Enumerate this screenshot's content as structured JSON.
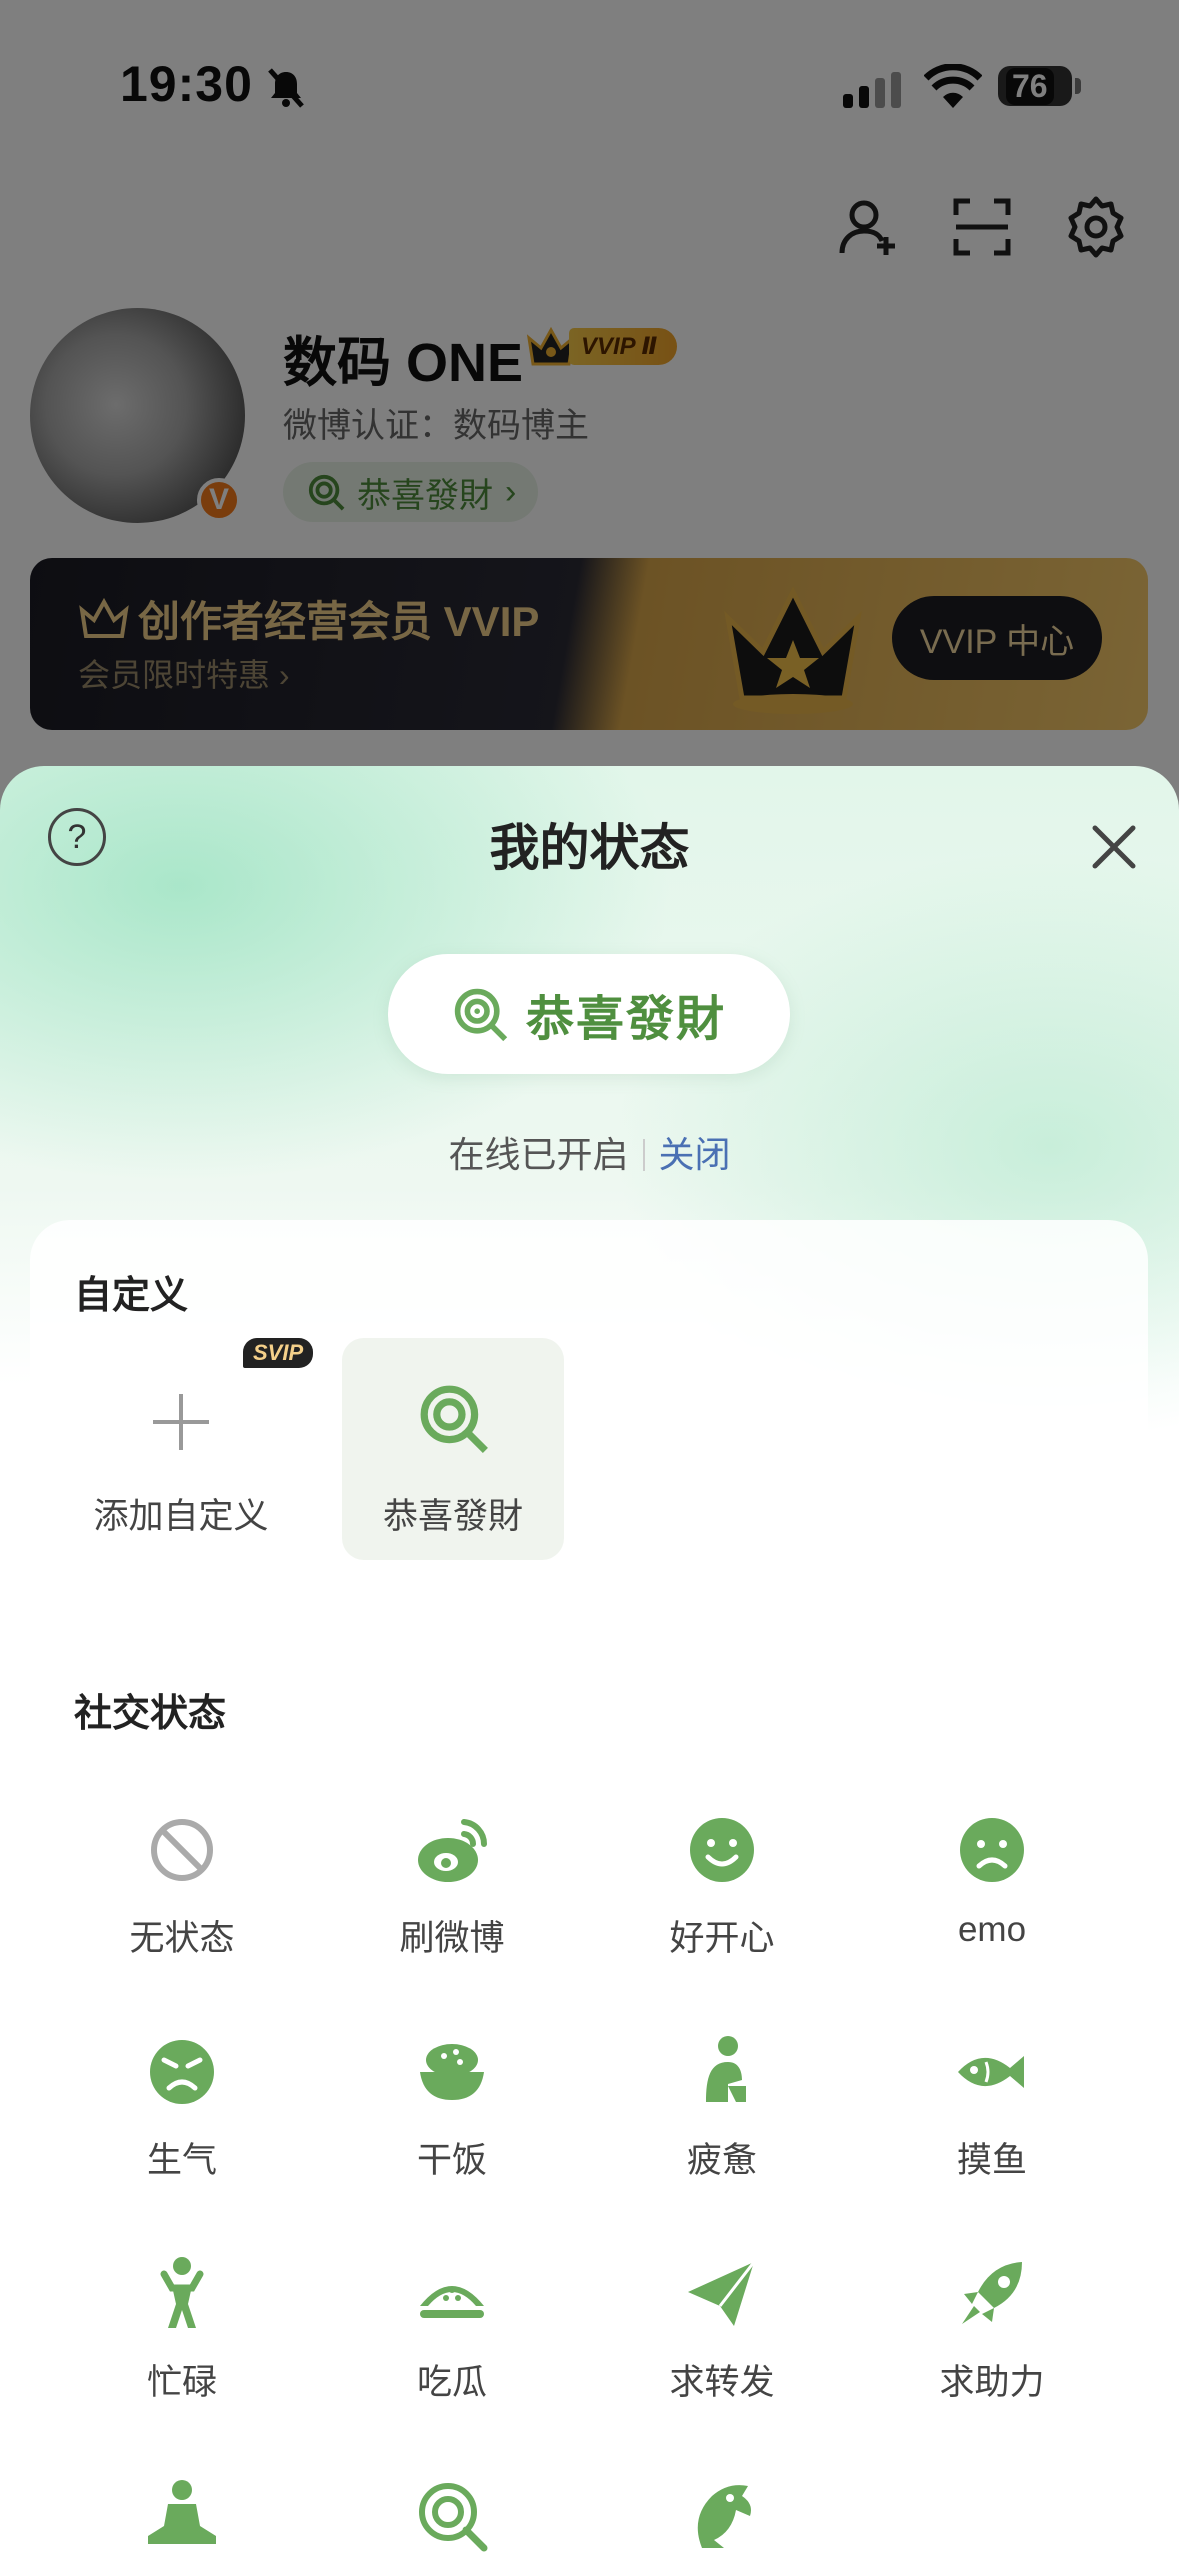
{
  "status_bar": {
    "time": "19:30",
    "battery": "76"
  },
  "profile": {
    "name": "数码 ONE",
    "vip_level": "VVIP Ⅱ",
    "verification": "微博认证：数码博主",
    "status_label": "恭喜發財",
    "avatar_badge": "V"
  },
  "banner": {
    "title": "创作者经营会员 VVIP",
    "subtitle": "会员限时特惠 ›",
    "button": "VVIP 中心"
  },
  "sheet": {
    "help_symbol": "?",
    "title": "我的状态",
    "current_status": "恭喜發財",
    "online_text": "在线已开启",
    "close_link": "关闭",
    "custom": {
      "title": "自定义",
      "add_label": "添加自定义",
      "svip_badge": "SVIP",
      "items": [
        {
          "label": "恭喜發財",
          "icon": "lollipop-icon"
        }
      ]
    },
    "social": {
      "title": "社交状态",
      "items": [
        {
          "label": "无状态",
          "icon": "no-status-icon"
        },
        {
          "label": "刷微博",
          "icon": "weibo-icon"
        },
        {
          "label": "好开心",
          "icon": "happy-face-icon"
        },
        {
          "label": "emo",
          "icon": "sad-face-icon"
        },
        {
          "label": "生气",
          "icon": "angry-face-icon"
        },
        {
          "label": "干饭",
          "icon": "rice-bowl-icon"
        },
        {
          "label": "疲惫",
          "icon": "tired-person-icon"
        },
        {
          "label": "摸鱼",
          "icon": "fish-icon"
        },
        {
          "label": "忙碌",
          "icon": "busy-person-icon"
        },
        {
          "label": "吃瓜",
          "icon": "watermelon-icon"
        },
        {
          "label": "求转发",
          "icon": "paper-plane-icon"
        },
        {
          "label": "求助力",
          "icon": "rocket-icon"
        },
        {
          "label": "",
          "icon": "meditation-icon"
        },
        {
          "label": "",
          "icon": "lollipop-icon"
        },
        {
          "label": "",
          "icon": "dolphin-icon"
        }
      ]
    }
  },
  "colors": {
    "accent_green": "#6aaa5c",
    "link_blue": "#4a70b3",
    "scrim": "rgba(0,0,0,0.5)"
  }
}
